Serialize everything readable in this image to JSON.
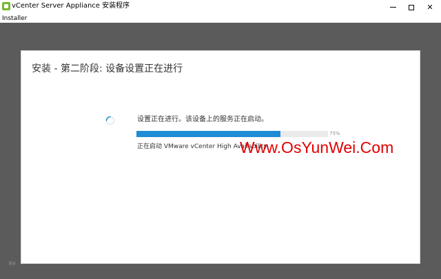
{
  "window": {
    "title": "vCenter Server Appliance 安装程序",
    "minimize_glyph": "—",
    "maximize_glyph": "☐",
    "close_glyph": "✕"
  },
  "menu": {
    "items": [
      {
        "label": "Installer"
      }
    ]
  },
  "background": {
    "partial_text": "联合"
  },
  "dialog": {
    "title": "安装 - 第二阶段: 设备设置正在进行",
    "status": "设置正在进行。该设备上的服务正在启动。",
    "progress_percent": 75,
    "progress_label": "75%",
    "substatus": "正在启动 VMware vCenter High Availability"
  },
  "watermark": {
    "text": "Www.OsYunWei.Com"
  },
  "colors": {
    "progress_fill": "#1f8dd6",
    "progress_track": "#eaeaea",
    "watermark": "#e00000",
    "backdrop": "#5b5b5b",
    "app_icon": "#78b833"
  },
  "icons": {
    "app": "vcenter-app-icon",
    "loading": "spinner-icon"
  }
}
